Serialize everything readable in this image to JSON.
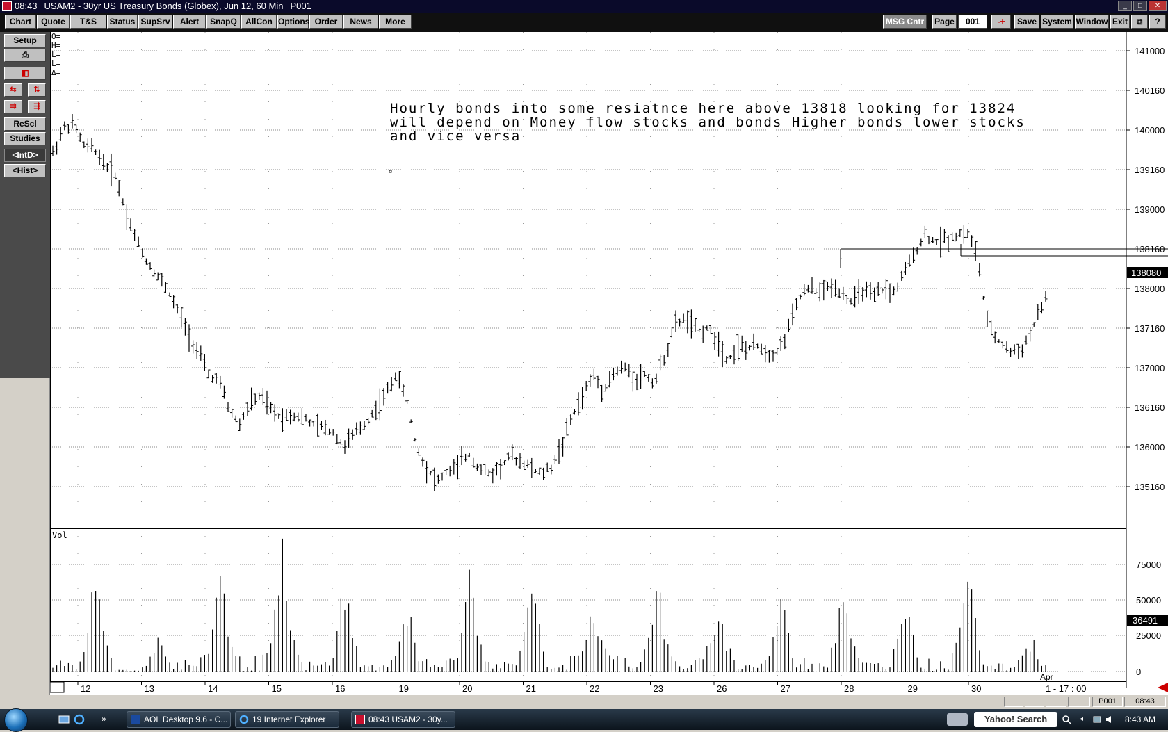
{
  "titlebar": {
    "time": "08:43",
    "title": "USAM2 - 30yr US Treasury Bonds (Globex), Jun 12, 60 Min",
    "page": "P001"
  },
  "menu": {
    "buttons": [
      "Chart",
      "Quote",
      "T&S",
      "Status",
      "SupSrv",
      "Alert",
      "SnapQ",
      "AllCon",
      "Options",
      "Order",
      "News",
      "More"
    ],
    "right": {
      "msg": "MSG Cntr",
      "page_label": "Page",
      "page_value": "001",
      "arrows": "-+",
      "save": "Save",
      "system": "System",
      "window": "Window",
      "exit": "Exit",
      "help": "?"
    }
  },
  "left_toolbar": {
    "setup": "Setup",
    "rescl": "ReScl",
    "studies": "Studies",
    "intd": "<IntD>",
    "hist": "<Hist>"
  },
  "chart": {
    "ohlc_labels": [
      "O=",
      "H=",
      "L=",
      "L=",
      "Δ="
    ],
    "annotation": [
      "Hourly bonds into some resiatnce here above 13818 looking for 13824",
      "will depend on Money flow stocks and bonds Higher bonds lower stocks",
      "and vice versa"
    ],
    "volume_label": "Vol"
  },
  "chart_data": {
    "type": "ohlc",
    "price_axis_ticks": [
      "141000",
      "140160",
      "140000",
      "139160",
      "139000",
      "138160",
      "138000",
      "137160",
      "137000",
      "136160",
      "136000",
      "135160"
    ],
    "last_price": "138080",
    "volume_axis_ticks": [
      "75000",
      "50000",
      "25000",
      "0"
    ],
    "last_volume": "36491",
    "x_tick_labels": [
      "12",
      "13",
      "14",
      "15",
      "16",
      "19",
      "20",
      "21",
      "22",
      "23",
      "26",
      "27",
      "28",
      "29",
      "30"
    ],
    "x_month_label": "Apr",
    "x_last_label": "1 - 17 : 00",
    "price_scale": [
      135.0,
      141.375
    ],
    "day_path": [
      [
        140.0,
        140.35,
        140.4,
        140.1,
        140.05,
        139.85,
        139.7
      ],
      [
        139.7,
        139.2,
        138.8,
        138.5,
        138.3,
        138.1,
        137.8
      ],
      [
        137.8,
        137.5,
        137.2,
        136.9,
        136.8,
        136.4,
        136.2
      ],
      [
        136.2,
        136.5,
        136.6,
        136.4,
        136.3,
        136.35,
        136.3
      ],
      [
        136.3,
        136.2,
        136.15,
        136.1,
        135.9,
        136.05,
        136.2
      ],
      [
        136.2,
        136.4,
        136.6,
        136.9,
        136.6,
        135.9,
        135.6
      ],
      [
        135.6,
        135.4,
        135.55,
        135.6,
        135.8,
        135.6,
        135.5
      ],
      [
        135.5,
        135.6,
        135.75,
        135.7,
        135.6,
        135.5,
        135.6
      ],
      [
        135.6,
        135.9,
        136.3,
        136.6,
        136.9,
        136.7,
        136.9
      ],
      [
        136.9,
        137.0,
        136.85,
        136.9,
        136.8,
        137.2,
        137.6
      ],
      [
        137.6,
        137.7,
        137.5,
        137.55,
        137.4,
        137.1,
        137.3
      ],
      [
        137.3,
        137.25,
        137.3,
        137.2,
        137.25,
        137.6,
        138.0
      ],
      [
        138.0,
        138.1,
        138.05,
        138.15,
        138.05,
        137.9,
        138.1
      ],
      [
        138.1,
        137.95,
        138.1,
        138.05,
        138.3,
        138.6,
        138.85
      ],
      [
        138.85,
        138.75,
        138.8,
        138.85,
        138.9,
        138.6,
        137.6
      ],
      [
        137.6,
        137.35,
        137.2,
        137.3,
        137.7,
        138.08
      ]
    ],
    "volume_path": [
      [
        8,
        80
      ],
      [
        2,
        28
      ],
      [
        10,
        95
      ],
      [
        12,
        100
      ],
      [
        8,
        72
      ],
      [
        6,
        58
      ],
      [
        10,
        82
      ],
      [
        8,
        68
      ],
      [
        12,
        58
      ],
      [
        14,
        72
      ],
      [
        10,
        60
      ],
      [
        8,
        62
      ],
      [
        12,
        68
      ],
      [
        8,
        62
      ],
      [
        10,
        90
      ],
      [
        6,
        30
      ]
    ]
  },
  "status": {
    "page": "P001",
    "time": "08:43"
  },
  "taskbar": {
    "items": [
      "AOL Desktop 9.6 - C...",
      "19 Internet Explorer",
      "08:43  USAM2 - 30y..."
    ],
    "search": "Yahoo! Search",
    "clock": "8:43 AM"
  }
}
